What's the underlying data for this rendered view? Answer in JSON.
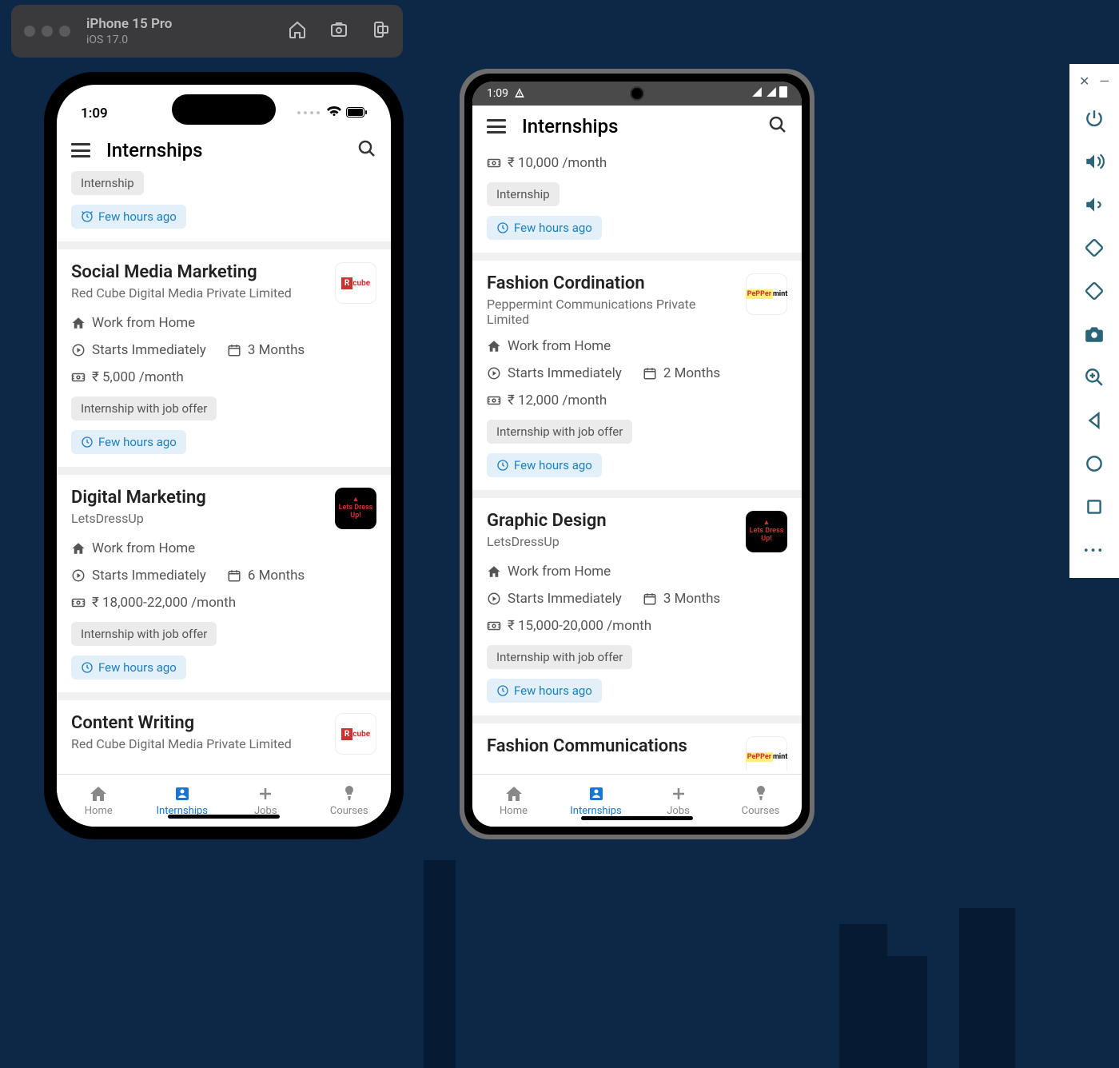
{
  "simulator": {
    "device": "iPhone 15 Pro",
    "os": "iOS 17.0"
  },
  "ios_status_time": "1:09",
  "android_status_time": "1:09",
  "app_title": "Internships",
  "labels": {
    "work_from_home": "Work from Home",
    "starts_immediately": "Starts Immediately"
  },
  "ios_partial_top": {
    "tag": "Internship",
    "posted": "Few hours ago"
  },
  "ios_cards": [
    {
      "title": "Social Media Marketing",
      "company": "Red Cube Digital Media Private Limited",
      "duration": "3 Months",
      "stipend": "₹ 5,000 /month",
      "tag": "Internship with job offer",
      "posted": "Few hours ago",
      "logo": "redcube"
    },
    {
      "title": "Digital Marketing",
      "company": "LetsDressUp",
      "duration": "6 Months",
      "stipend": "₹ 18,000-22,000 /month",
      "tag": "Internship with job offer",
      "posted": "Few hours ago",
      "logo": "ldu"
    }
  ],
  "ios_partial_bottom": {
    "title": "Content Writing",
    "company": "Red Cube Digital Media Private Limited",
    "logo": "redcube"
  },
  "android_partial_top": {
    "stipend": "₹ 10,000 /month",
    "tag": "Internship",
    "posted": "Few hours ago"
  },
  "android_cards": [
    {
      "title": "Fashion Cordination",
      "company": "Peppermint Communications Private Limited",
      "duration": "2 Months",
      "stipend": "₹ 12,000 /month",
      "tag": "Internship with job offer",
      "posted": "Few hours ago",
      "logo": "pepper"
    },
    {
      "title": "Graphic Design",
      "company": "LetsDressUp",
      "duration": "3 Months",
      "stipend": "₹ 15,000-20,000 /month",
      "tag": "Internship with job offer",
      "posted": "Few hours ago",
      "logo": "ldu"
    }
  ],
  "android_partial_bottom": {
    "title": "Fashion Communications",
    "logo": "pepper"
  },
  "bottom_nav": [
    {
      "label": "Home",
      "active": false
    },
    {
      "label": "Internships",
      "active": true
    },
    {
      "label": "Jobs",
      "active": false
    },
    {
      "label": "Courses",
      "active": false
    }
  ]
}
